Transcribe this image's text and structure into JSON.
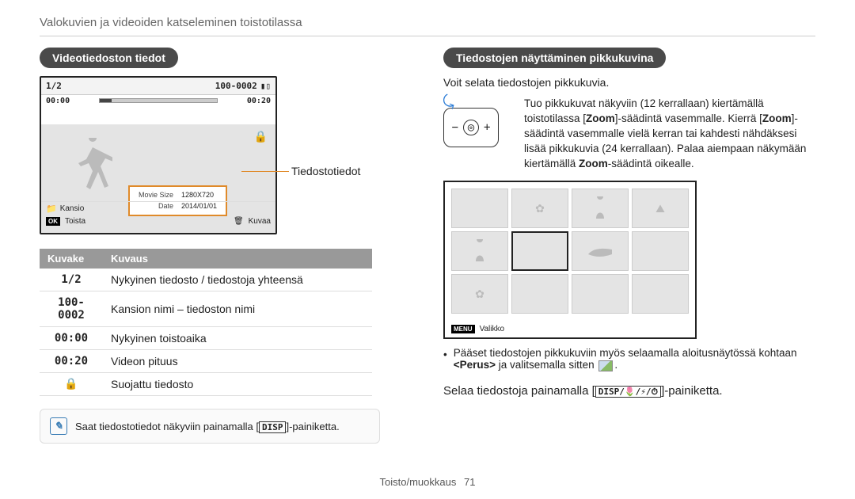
{
  "header": "Valokuvien ja videoiden katseleminen toistotilassa",
  "left": {
    "heading": "Videotiedoston tiedot",
    "cam": {
      "index": "1/2",
      "folder_file": "100-0002",
      "length": "00:20",
      "current": "00:00",
      "info_rows": [
        {
          "label": "Movie Size",
          "value": "1280X720"
        },
        {
          "label": "Date",
          "value": "2014/01/01"
        }
      ],
      "folder_label": "Kansio",
      "ok_label": "OK",
      "play_label": "Toista",
      "trash_label": "Kuvaa"
    },
    "side_label": "Tiedostotiedot",
    "table": {
      "head_icon": "Kuvake",
      "head_desc": "Kuvaus",
      "rows": [
        {
          "icon": "1/2",
          "desc": "Nykyinen tiedosto / tiedostoja yhteensä"
        },
        {
          "icon": "100-0002",
          "desc": "Kansion nimi – tiedoston nimi"
        },
        {
          "icon": "00:00",
          "desc": "Nykyinen toistoaika"
        },
        {
          "icon": "00:20",
          "desc": "Videon pituus"
        },
        {
          "icon": "🔒",
          "desc": "Suojattu tiedosto"
        }
      ]
    },
    "note_prefix": "Saat tiedostotiedot näkyviin painamalla [",
    "note_key": "DISP",
    "note_suffix": "]-painiketta."
  },
  "right": {
    "heading": "Tiedostojen näyttäminen pikkukuvina",
    "intro": "Voit selata tiedostojen pikkukuvia.",
    "zoom_text_1a": "Tuo pikkukuvat näkyviin (12 kerrallaan) kiertämällä toistotilassa [",
    "zoom_text_1b": "]-säädintä vasemmalle. Kierrä [",
    "zoom_text_1c": "]-säädintä vasemmalle vielä kerran tai kahdesti nähdäksesi lisää pikkukuvia (24 kerrallaan). Palaa aiempaan näkymään kiertämällä ",
    "zoom_text_1d": "-säädintä oikealle.",
    "zoom_word": "Zoom",
    "thumb_menu": "MENU",
    "thumb_menu_label": "Valikko",
    "bullet_1a": "Pääset tiedostojen pikkukuviin myös selaamalla aloitusnäytössä kohtaan ",
    "bullet_1b": "<Perus>",
    "bullet_1c": " ja valitsemalla sitten ",
    "bullet_1d": ".",
    "nav_prefix": "Selaa tiedostoja painamalla [",
    "nav_keys": "DISP/🌷/⚡/⏱",
    "nav_suffix": "]-painiketta."
  },
  "footer": {
    "section": "Toisto/muokkaus",
    "page": "71"
  }
}
